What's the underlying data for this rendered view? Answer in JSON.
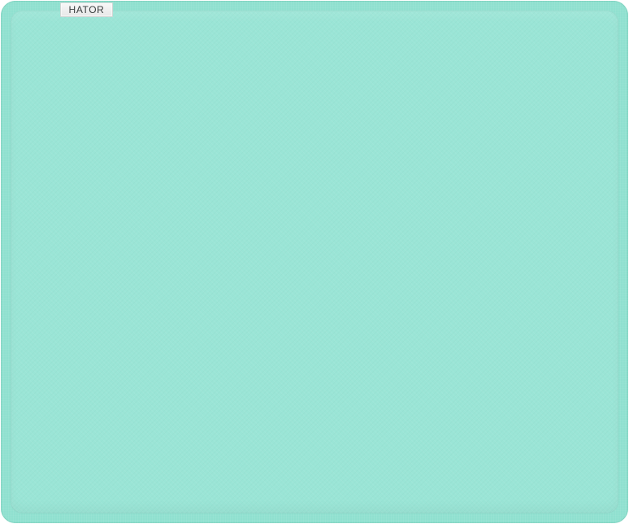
{
  "image": {
    "subject": "mouse pad",
    "brand_tag": {
      "text": "HATOR"
    },
    "colors": {
      "background": "#ffffff",
      "pad_surface": "#9ae5d6",
      "pad_border": "#8fe0cf",
      "logo_tag": "#f1f1f1",
      "logo_text": "#3a3f3f"
    }
  }
}
